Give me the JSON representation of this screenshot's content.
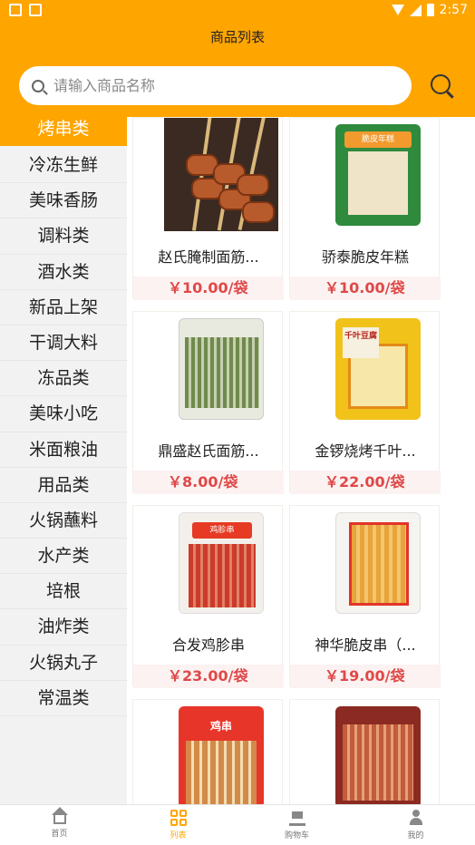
{
  "status_bar": {
    "time": "2:57"
  },
  "header": {
    "title": "商品列表"
  },
  "search": {
    "placeholder": "请输入商品名称"
  },
  "sidebar": {
    "items": [
      {
        "label": "烤串类",
        "active": true
      },
      {
        "label": "冷冻生鲜"
      },
      {
        "label": "美味香肠"
      },
      {
        "label": "调料类"
      },
      {
        "label": "酒水类"
      },
      {
        "label": "新品上架"
      },
      {
        "label": "干调大料"
      },
      {
        "label": "冻品类"
      },
      {
        "label": "美味小吃"
      },
      {
        "label": "米面粮油"
      },
      {
        "label": "用品类"
      },
      {
        "label": "火锅蘸料"
      },
      {
        "label": "水产类"
      },
      {
        "label": "培根"
      },
      {
        "label": "油炸类"
      },
      {
        "label": "火锅丸子"
      },
      {
        "label": "常温类"
      }
    ]
  },
  "products": [
    {
      "name": "赵氏腌制面筋...",
      "price": "￥10.00/袋",
      "image": "grilled-skewers-photo"
    },
    {
      "name": "骄泰脆皮年糕",
      "price": "￥10.00/袋",
      "image": "green-bag-photo",
      "bag_label": "脆皮年糕"
    },
    {
      "name": "鼎盛赵氏面筋...",
      "price": "￥8.00/袋",
      "image": "clear-bag-photo"
    },
    {
      "name": "金锣烧烤千叶...",
      "price": "￥22.00/袋",
      "image": "yellow-bag-photo",
      "bag_label": "千叶豆腐"
    },
    {
      "name": "合发鸡胗串",
      "price": "￥23.00/袋",
      "image": "red-bag-photo",
      "bag_label": "鸡胗串"
    },
    {
      "name": "神华脆皮串（...",
      "price": "￥19.00/袋",
      "image": "tan-bag-photo"
    },
    {
      "name": "",
      "price": "",
      "image": "orange-bag-photo",
      "bag_label": "鸡串"
    },
    {
      "name": "",
      "price": "",
      "image": "dark-bag-photo"
    }
  ],
  "tabbar": {
    "tabs": [
      {
        "label": "首页",
        "icon": "home-icon"
      },
      {
        "label": "列表",
        "icon": "grid-icon",
        "active": true
      },
      {
        "label": "购物车",
        "icon": "cart-icon"
      },
      {
        "label": "我的",
        "icon": "user-icon"
      }
    ]
  },
  "colors": {
    "accent": "#ffa500",
    "price": "#e04848",
    "price_bg": "#fbf2f1"
  }
}
